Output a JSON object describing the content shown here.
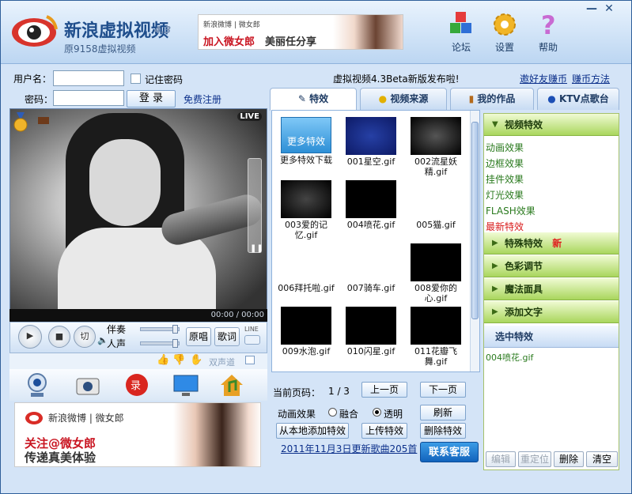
{
  "app": {
    "title": "新浪虚拟视频",
    "version": "4.3",
    "subtitle": "原9158虚拟视频"
  },
  "top_ad": {
    "brand": "新浪微博 | 微女郎",
    "line1": "加入微女郎",
    "line2": "美丽任分享"
  },
  "top_buttons": [
    {
      "label": "论坛",
      "icon": "cubes-icon"
    },
    {
      "label": "设置",
      "icon": "gear-icon"
    },
    {
      "label": "帮助",
      "icon": "question-icon"
    }
  ],
  "window_controls": {
    "minimize": "—",
    "close": "✕"
  },
  "login": {
    "username_label": "用户名：",
    "password_label": "密码：",
    "remember": "记住密码",
    "login_button": "登 录",
    "register_link": "免费注册",
    "username_value": "",
    "password_value": ""
  },
  "video": {
    "live_badge": "LIVE",
    "time": "00:00 / 00:00"
  },
  "player": {
    "btn_cut": "切",
    "accompany_label": "伴奏",
    "voice_label": "人声",
    "original_btn": "原唱",
    "lyrics_btn": "歌词",
    "line_label": "LINE",
    "channel_label": "双声道"
  },
  "bottom_ad": {
    "brand": "新浪微博 | 微女郎",
    "line1": "关注@微女郎",
    "line2": "传递真美体验"
  },
  "news": {
    "headline": "虚拟视频4.3Beta新版发布啦!",
    "invite_link": "邀好友赚币",
    "earn_link": "赚币方法"
  },
  "tabs": [
    {
      "label": "特效",
      "active": true
    },
    {
      "label": "视频来源",
      "active": false
    },
    {
      "label": "我的作品",
      "active": false
    },
    {
      "label": "KTV点歌台",
      "active": false
    }
  ],
  "effects": [
    {
      "caption": "更多特效下载",
      "button": "更多特效"
    },
    {
      "caption": "001星空.gif"
    },
    {
      "caption": "002流星妖精.gif"
    },
    {
      "caption": "003爱的记忆.gif"
    },
    {
      "caption": "004喷花.gif"
    },
    {
      "caption": "005猫.gif"
    },
    {
      "caption": "006拜托啦.gif"
    },
    {
      "caption": "007骑车.gif"
    },
    {
      "caption": "008爱你的心.gif"
    },
    {
      "caption": "009水泡.gif"
    },
    {
      "caption": "010闪星.gif"
    },
    {
      "caption": "011花瓣飞舞.gif"
    }
  ],
  "pager": {
    "label": "当前页码：",
    "value": "1 / 3",
    "prev": "上一页",
    "next": "下一页",
    "anim_label": "动画效果",
    "opt_blend": "融合",
    "opt_transparent": "透明",
    "refresh": "刷新",
    "add_local": "从本地添加特效",
    "upload": "上传特效",
    "delete": "删除特效",
    "update_note": "2011年11月3日更新歌曲205首",
    "service": "联系客服"
  },
  "side": {
    "video_effects": "视频特效",
    "sub_items": [
      "动画效果",
      "边框效果",
      "挂件效果",
      "灯光效果",
      "FLASH效果",
      "最新特效"
    ],
    "special": "特殊特效",
    "special_badge": "新",
    "color": "色彩调节",
    "mask": "魔法面具",
    "text": "添加文字",
    "selected_title": "选中特效",
    "selected_item": "004喷花.gif",
    "btn_edit": "编辑",
    "btn_reposition": "重定位",
    "btn_delete": "删除",
    "btn_clear": "清空"
  }
}
